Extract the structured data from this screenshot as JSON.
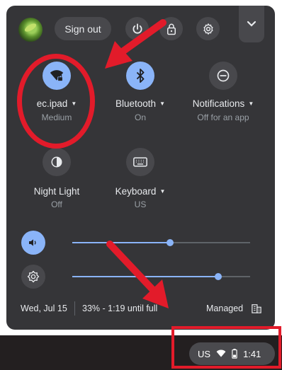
{
  "header": {
    "sign_out_label": "Sign out",
    "buttons": [
      "power-icon",
      "lock-icon",
      "gear-icon",
      "chevron-down-icon"
    ]
  },
  "tiles": [
    {
      "label": "ec.ipad",
      "sub": "Medium",
      "icon": "wifi-icon",
      "active": true
    },
    {
      "label": "Bluetooth",
      "sub": "On",
      "icon": "bluetooth-icon",
      "active": true
    },
    {
      "label": "Notifications",
      "sub": "Off for an app",
      "icon": "do-not-disturb-icon",
      "active": false
    },
    {
      "label": "Night Light",
      "sub": "Off",
      "icon": "night-light-icon",
      "active": false
    },
    {
      "label": "Keyboard",
      "sub": "US",
      "icon": "keyboard-icon",
      "active": false
    }
  ],
  "sliders": {
    "volume": {
      "level": 0.55,
      "icon": "volume-icon"
    },
    "brightness": {
      "level": 0.82,
      "icon": "brightness-icon"
    }
  },
  "footer": {
    "date": "Wed, Jul 15",
    "battery": "33% - 1:19 until full",
    "managed": "Managed",
    "managed_icon": "building-icon"
  },
  "shelf": {
    "ime": "US",
    "time": "1:41",
    "icons": [
      "wifi-icon",
      "battery-icon"
    ]
  },
  "colors": {
    "panel": "#353538",
    "accent": "#8ab4f8",
    "annotation": "#e21b2a"
  }
}
